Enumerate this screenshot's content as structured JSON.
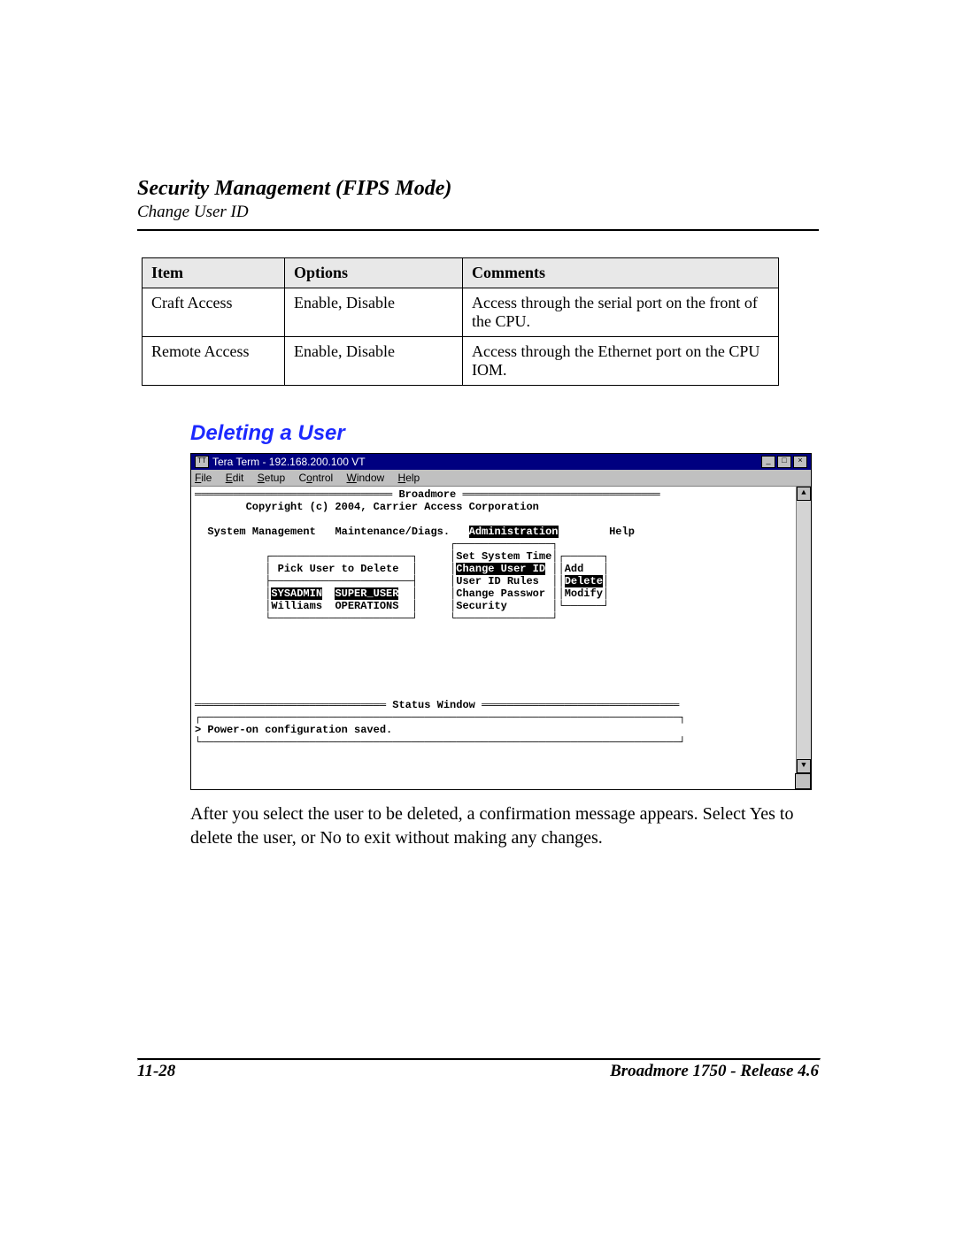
{
  "header": {
    "chapter_title": "Security Management (FIPS Mode)",
    "subsection": "Change User ID"
  },
  "table": {
    "headers": {
      "item": "Item",
      "options": "Options",
      "comments": "Comments"
    },
    "rows": [
      {
        "item": "Craft Access",
        "options": "Enable, Disable",
        "comments": "Access through the serial port on the front of the CPU."
      },
      {
        "item": "Remote Access",
        "options": "Enable, Disable",
        "comments": "Access through the Ethernet port on the CPU IOM."
      }
    ]
  },
  "section_heading": "Deleting a User",
  "teraterm": {
    "title": "Tera Term - 192.168.200.100 VT",
    "window_controls": {
      "min": "_",
      "max": "□",
      "close": "×"
    },
    "menu": {
      "file": "File",
      "edit": "Edit",
      "setup": "Setup",
      "control": "Control",
      "window": "Window",
      "help": "Help"
    },
    "app_header": "Broadmore",
    "copyright": "Copyright (c) 2004, Carrier Access Corporation",
    "app_menu": {
      "sys_mgmt": "System Management",
      "maint": "Maintenance/Diags.",
      "admin": "Administration",
      "help": "Help"
    },
    "pick_prompt": "Pick User to Delete",
    "users": {
      "u1a": "SYSADMIN",
      "u1b": "SUPER_USER",
      "u2a": "Williams",
      "u2b": "OPERATIONS"
    },
    "admin_sub": {
      "set_time": "Set System Time",
      "change_uid": "Change User ID",
      "uid_rules": "User ID Rules",
      "change_pw": "Change Passwor",
      "security": "Security"
    },
    "uid_sub": {
      "add": "Add",
      "delete": "Delete",
      "modify": "Modify"
    },
    "status_label": "Status Window",
    "status_line": "> Power-on configuration saved."
  },
  "body_paragraph": "After you select the user to be deleted, a confirmation message appears. Select Yes to delete the user, or No to exit without making any changes.",
  "footer": {
    "page": "11-28",
    "release": "Broadmore 1750 - Release 4.6"
  }
}
